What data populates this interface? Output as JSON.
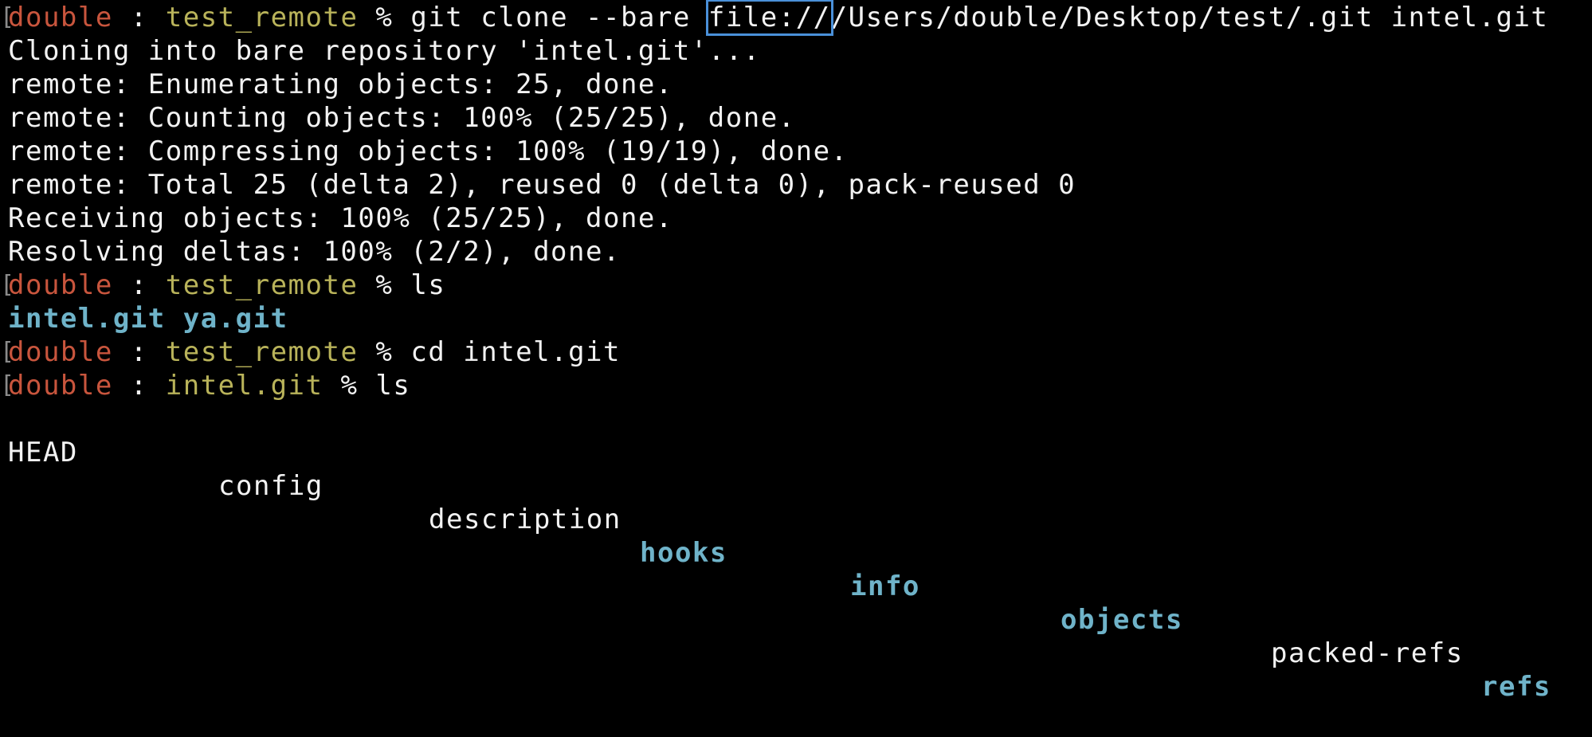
{
  "colors": {
    "background": "#000000",
    "text": "#f2f2f2",
    "prompt_user": "#c8553d",
    "prompt_dir": "#b9b35a",
    "directory_listing": "#6fb3c9",
    "highlight_box": "#4a90d9"
  },
  "prompt": {
    "user": "double",
    "separator": " : ",
    "symbol": " % "
  },
  "line1": {
    "dir": "test_remote",
    "cmd_before": "git clone --bare ",
    "cmd_highlight": "file://",
    "cmd_after": "/Users/double/Desktop/test/.git intel.git"
  },
  "output": [
    "Cloning into bare repository 'intel.git'...",
    "remote: Enumerating objects: 25, done.",
    "remote: Counting objects: 100% (25/25), done.",
    "remote: Compressing objects: 100% (19/19), done.",
    "remote: Total 25 (delta 2), reused 0 (delta 0), pack-reused 0",
    "Receiving objects: 100% (25/25), done.",
    "Resolving deltas: 100% (2/2), done."
  ],
  "line9": {
    "dir": "test_remote",
    "cmd": "ls"
  },
  "ls1": {
    "a": "intel.git",
    "b": "ya.git"
  },
  "line11": {
    "dir": "test_remote",
    "cmd": "cd intel.git"
  },
  "line12": {
    "dir": "intel.git",
    "cmd": "ls"
  },
  "ls2": {
    "head": "HEAD",
    "config": "config",
    "description": "description",
    "hooks": "hooks",
    "info": "info",
    "objects": "objects",
    "packed_refs": "packed-refs",
    "refs": "refs"
  }
}
